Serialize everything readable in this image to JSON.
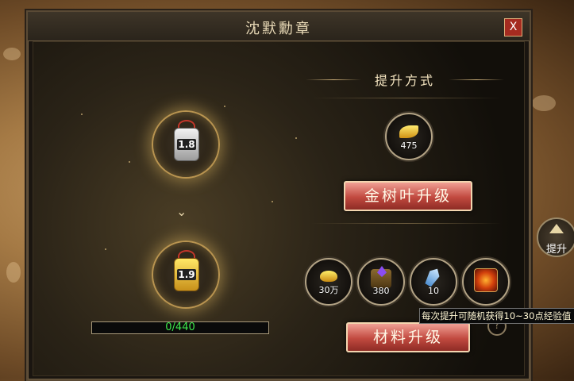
{
  "window": {
    "title": "沈默勳章",
    "close_label": "X"
  },
  "medals": [
    {
      "level": "1.8",
      "style": "silver"
    },
    {
      "level": "1.9",
      "style": "gold"
    }
  ],
  "upgrade": {
    "section_title": "提升方式",
    "leaf_item": {
      "icon": "gold-leaf-icon",
      "quantity": "475"
    },
    "leaf_button_label": "金树叶升级",
    "materials": [
      {
        "icon": "gold-ingot-icon",
        "quantity": "30万"
      },
      {
        "icon": "material-sack-icon",
        "quantity": "380"
      },
      {
        "icon": "crystal-shard-icon",
        "quantity": "10"
      },
      {
        "icon": "fire-orb-icon",
        "quantity": ""
      }
    ],
    "material_button_label": "材料升级",
    "tooltip": "每次提升可随机获得10~30点经验值"
  },
  "progress": {
    "text": "0/440",
    "current": 0,
    "max": 440
  },
  "side_button": {
    "label": "提升"
  },
  "colors": {
    "button_red": "#c1493f",
    "progress_text": "#3ce84a",
    "close_red": "#a52b20"
  }
}
